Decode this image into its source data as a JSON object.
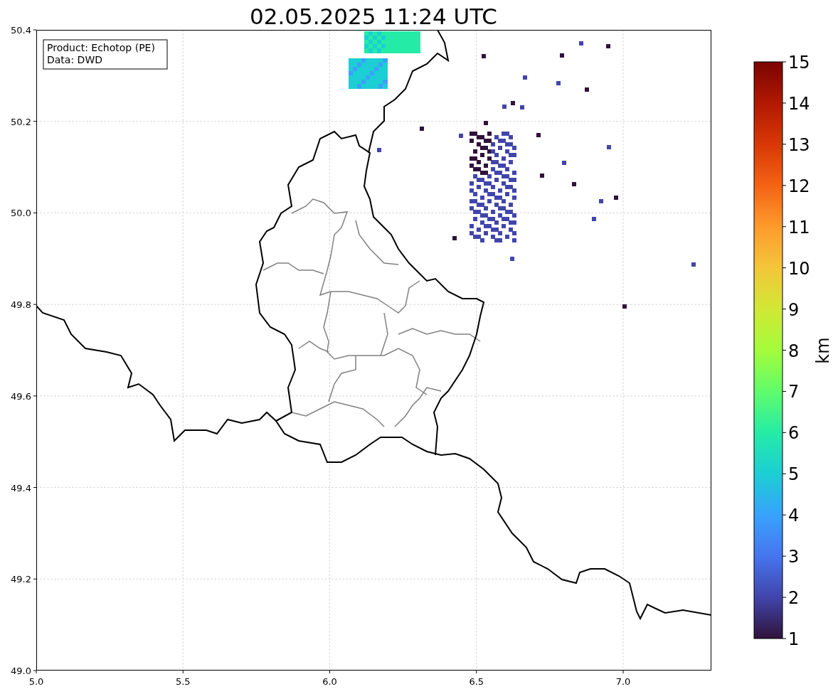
{
  "title": "02.05.2025 11:24 UTC",
  "info_box": [
    "Product: Echotop (PE)",
    "Data: DWD"
  ],
  "map": {
    "xticks": [
      "5.0",
      "5.5",
      "6.0",
      "6.5",
      "7.0"
    ],
    "yticks": [
      "50.4",
      "50.2",
      "50.0",
      "49.8",
      "49.6",
      "49.4",
      "49.2",
      "49.0"
    ]
  },
  "colorbar": {
    "label": "km",
    "ticks": [
      "15",
      "14",
      "13",
      "12",
      "11",
      "10",
      "9",
      "8",
      "7",
      "6",
      "5",
      "4",
      "3",
      "2",
      "1"
    ]
  }
}
